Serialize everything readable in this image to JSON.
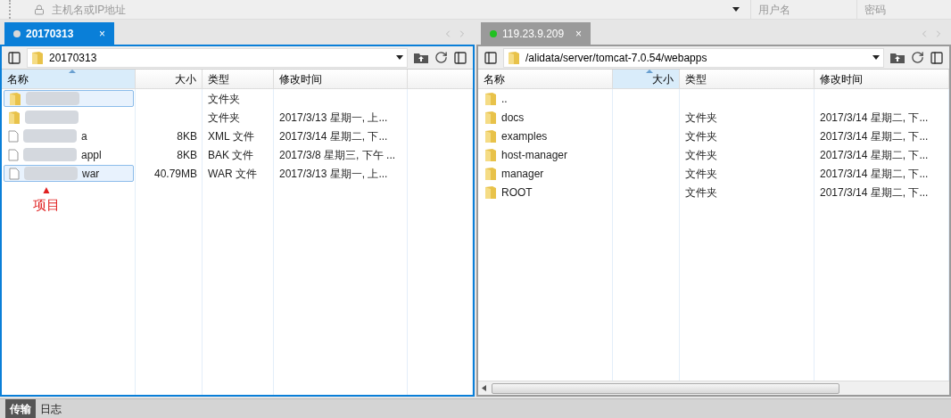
{
  "connection": {
    "host_placeholder": "主机名或IP地址",
    "user_placeholder": "用户名",
    "password_placeholder": "密码"
  },
  "panes": [
    {
      "tab": {
        "label": "20170313",
        "close": "×",
        "connected": false,
        "focused": true
      },
      "path": "20170313",
      "columns": [
        {
          "label": "名称",
          "sorted": true
        },
        {
          "label": "大小",
          "sorted": false
        },
        {
          "label": "类型",
          "sorted": false
        },
        {
          "label": "修改时间",
          "sorted": false
        }
      ],
      "rows": [
        {
          "type": "文件夹",
          "selected": true,
          "redacted": true,
          "folder": true
        },
        {
          "type": "文件夹",
          "modified": "2017/3/13 星期一, 上...",
          "selected": false,
          "redacted": true,
          "folder": true
        },
        {
          "name": "a",
          "size": "8KB",
          "type": "XML 文件",
          "modified": "2017/3/14 星期二, 下...",
          "selected": false,
          "redacted": true,
          "folder": false
        },
        {
          "name": "appl",
          "size": "8KB",
          "type": "BAK 文件",
          "modified": "2017/3/8 星期三, 下午 ...",
          "selected": false,
          "redacted": true,
          "folder": false
        },
        {
          "name": "war",
          "size": "40.79MB",
          "type": "WAR 文件",
          "modified": "2017/3/13 星期一, 上...",
          "selected": true,
          "redacted": true,
          "folder": false
        }
      ],
      "annotation": {
        "marker": "▲",
        "label": "项目"
      }
    },
    {
      "tab": {
        "label": "119.23.9.209",
        "close": "×",
        "connected": true,
        "focused": false
      },
      "path": "/alidata/server/tomcat-7.0.54/webapps",
      "columns": [
        {
          "label": "名称",
          "sorted": false
        },
        {
          "label": "大小",
          "sorted": true
        },
        {
          "label": "类型",
          "sorted": false
        },
        {
          "label": "修改时间",
          "sorted": false
        }
      ],
      "rows": [
        {
          "name": "..",
          "selected": false,
          "redacted": false,
          "folder": true
        },
        {
          "name": "docs",
          "type": "文件夹",
          "modified": "2017/3/14 星期二, 下...",
          "selected": false,
          "redacted": false,
          "folder": true
        },
        {
          "name": "examples",
          "type": "文件夹",
          "modified": "2017/3/14 星期二, 下...",
          "selected": false,
          "redacted": false,
          "folder": true
        },
        {
          "name": "host-manager",
          "type": "文件夹",
          "modified": "2017/3/14 星期二, 下...",
          "selected": false,
          "redacted": false,
          "folder": true
        },
        {
          "name": "manager",
          "type": "文件夹",
          "modified": "2017/3/14 星期二, 下...",
          "selected": false,
          "redacted": false,
          "folder": true
        },
        {
          "name": "ROOT",
          "type": "文件夹",
          "modified": "2017/3/14 星期二, 下...",
          "selected": false,
          "redacted": false,
          "folder": true
        }
      ]
    }
  ],
  "bottom_tabs": [
    {
      "label": "传输",
      "selected": true
    },
    {
      "label": "日志",
      "selected": false
    }
  ]
}
